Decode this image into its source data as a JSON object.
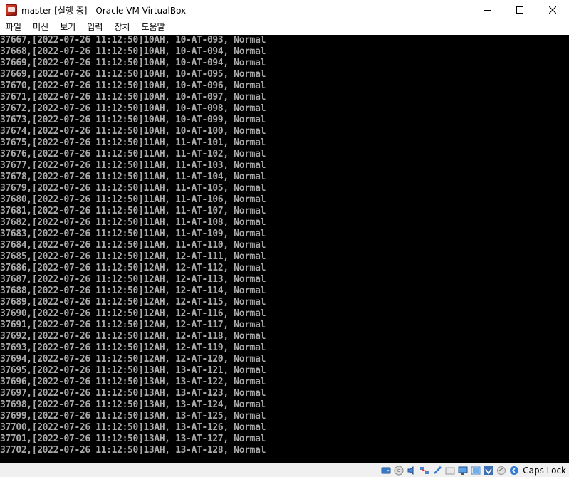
{
  "window": {
    "title": "master [실행 중] - Oracle VM VirtualBox"
  },
  "menu": {
    "items": [
      "파일",
      "머신",
      "보기",
      "입력",
      "장치",
      "도움말"
    ]
  },
  "console": {
    "lines": [
      "37667,[2022-07-26 11:12:50]10AH, 10-AT-093, Normal",
      "37668,[2022-07-26 11:12:50]10AH, 10-AT-094, Normal",
      "37669,[2022-07-26 11:12:50]10AH, 10-AT-094, Normal",
      "37669,[2022-07-26 11:12:50]10AH, 10-AT-095, Normal",
      "37670,[2022-07-26 11:12:50]10AH, 10-AT-096, Normal",
      "37671,[2022-07-26 11:12:50]10AH, 10-AT-097, Normal",
      "37672,[2022-07-26 11:12:50]10AH, 10-AT-098, Normal",
      "37673,[2022-07-26 11:12:50]10AH, 10-AT-099, Normal",
      "37674,[2022-07-26 11:12:50]10AH, 10-AT-100, Normal",
      "37675,[2022-07-26 11:12:50]11AH, 11-AT-101, Normal",
      "37676,[2022-07-26 11:12:50]11AH, 11-AT-102, Normal",
      "37677,[2022-07-26 11:12:50]11AH, 11-AT-103, Normal",
      "37678,[2022-07-26 11:12:50]11AH, 11-AT-104, Normal",
      "37679,[2022-07-26 11:12:50]11AH, 11-AT-105, Normal",
      "37680,[2022-07-26 11:12:50]11AH, 11-AT-106, Normal",
      "37681,[2022-07-26 11:12:50]11AH, 11-AT-107, Normal",
      "37682,[2022-07-26 11:12:50]11AH, 11-AT-108, Normal",
      "37683,[2022-07-26 11:12:50]11AH, 11-AT-109, Normal",
      "37684,[2022-07-26 11:12:50]11AH, 11-AT-110, Normal",
      "37685,[2022-07-26 11:12:50]12AH, 12-AT-111, Normal",
      "37686,[2022-07-26 11:12:50]12AH, 12-AT-112, Normal",
      "37687,[2022-07-26 11:12:50]12AH, 12-AT-113, Normal",
      "37688,[2022-07-26 11:12:50]12AH, 12-AT-114, Normal",
      "37689,[2022-07-26 11:12:50]12AH, 12-AT-115, Normal",
      "37690,[2022-07-26 11:12:50]12AH, 12-AT-116, Normal",
      "37691,[2022-07-26 11:12:50]12AH, 12-AT-117, Normal",
      "37692,[2022-07-26 11:12:50]12AH, 12-AT-118, Normal",
      "37693,[2022-07-26 11:12:50]12AH, 12-AT-119, Normal",
      "37694,[2022-07-26 11:12:50]12AH, 12-AT-120, Normal",
      "37695,[2022-07-26 11:12:50]13AH, 13-AT-121, Normal",
      "37696,[2022-07-26 11:12:50]13AH, 13-AT-122, Normal",
      "37697,[2022-07-26 11:12:50]13AH, 13-AT-123, Normal",
      "37698,[2022-07-26 11:12:50]13AH, 13-AT-124, Normal",
      "37699,[2022-07-26 11:12:50]13AH, 13-AT-125, Normal",
      "37700,[2022-07-26 11:12:50]13AH, 13-AT-126, Normal",
      "37701,[2022-07-26 11:12:50]13AH, 13-AT-127, Normal",
      "37702,[2022-07-26 11:12:50]13AH, 13-AT-128, Normal"
    ]
  },
  "statusbar": {
    "icons": [
      "hard-disk-icon",
      "optical-drive-icon",
      "audio-icon",
      "network-icon",
      "usb-icon",
      "shared-folders-icon",
      "display-icon",
      "video-capture-icon",
      "virtualization-icon",
      "mouse-integration-icon",
      "host-key-icon"
    ],
    "caps_lock_label": "Caps Lock"
  }
}
